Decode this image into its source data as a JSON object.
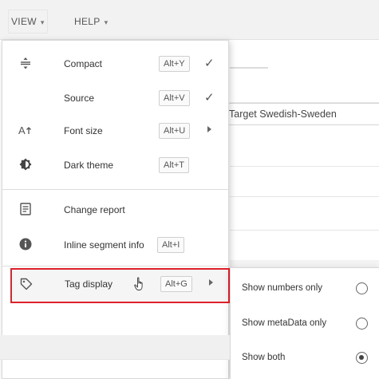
{
  "menubar": {
    "view": {
      "label": "VIEW",
      "caret": "▾"
    },
    "help": {
      "label": "HELP",
      "caret": "▾"
    }
  },
  "background": {
    "target_language": "Target Swedish-Sweden"
  },
  "view_menu": {
    "items": [
      {
        "label": "Compact",
        "shortcut": "Alt+Y",
        "checked": true,
        "icon": "compact-icon",
        "check": "✓"
      },
      {
        "label": "Source",
        "shortcut": "Alt+V",
        "checked": true,
        "icon": "",
        "check": "✓"
      },
      {
        "label": "Font size",
        "shortcut": "Alt+U",
        "submenu": true,
        "icon": "font-size-icon"
      },
      {
        "label": "Dark theme",
        "shortcut": "Alt+T",
        "icon": "dark-theme-icon"
      },
      {
        "label": "Change report",
        "icon": "report-icon"
      },
      {
        "label": "Inline segment info",
        "shortcut": "Alt+I",
        "icon": "info-icon"
      },
      {
        "label": "Tag display",
        "shortcut": "Alt+G",
        "submenu": true,
        "icon": "tag-icon",
        "highlighted": true
      }
    ]
  },
  "tag_display_submenu": {
    "options": [
      {
        "label": "Show numbers only",
        "selected": false
      },
      {
        "label": "Show metaData only",
        "selected": false
      },
      {
        "label": "Show both",
        "selected": true
      }
    ]
  },
  "colors": {
    "highlight_border": "#e0202a",
    "menubar_bg": "#f2f2f2"
  }
}
